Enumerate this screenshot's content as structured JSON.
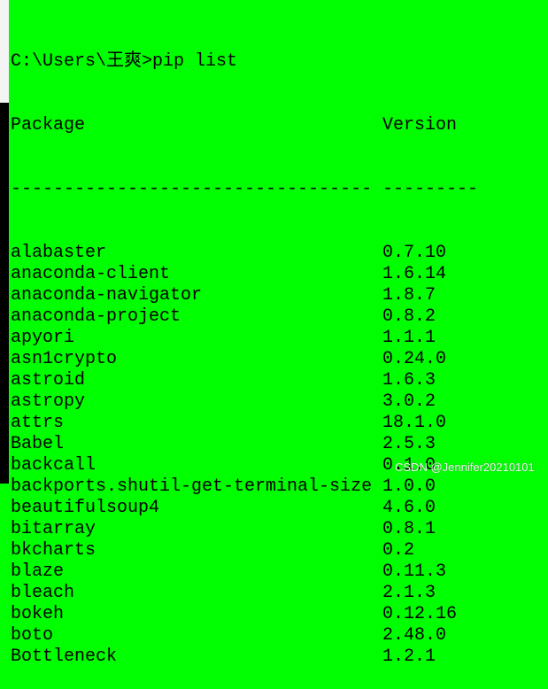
{
  "prompt": "C:\\Users\\王爽>pip list",
  "header": {
    "package": "Package",
    "version": "Version"
  },
  "separator": {
    "package": "----------------------------------",
    "version": "---------"
  },
  "packages": [
    {
      "name": "alabaster",
      "version": "0.7.10"
    },
    {
      "name": "anaconda-client",
      "version": "1.6.14"
    },
    {
      "name": "anaconda-navigator",
      "version": "1.8.7"
    },
    {
      "name": "anaconda-project",
      "version": "0.8.2"
    },
    {
      "name": "apyori",
      "version": "1.1.1"
    },
    {
      "name": "asn1crypto",
      "version": "0.24.0"
    },
    {
      "name": "astroid",
      "version": "1.6.3"
    },
    {
      "name": "astropy",
      "version": "3.0.2"
    },
    {
      "name": "attrs",
      "version": "18.1.0"
    },
    {
      "name": "Babel",
      "version": "2.5.3"
    },
    {
      "name": "backcall",
      "version": "0.1.0"
    },
    {
      "name": "backports.shutil-get-terminal-size",
      "version": "1.0.0"
    },
    {
      "name": "beautifulsoup4",
      "version": "4.6.0"
    },
    {
      "name": "bitarray",
      "version": "0.8.1"
    },
    {
      "name": "bkcharts",
      "version": "0.2"
    },
    {
      "name": "blaze",
      "version": "0.11.3"
    },
    {
      "name": "bleach",
      "version": "2.1.3"
    },
    {
      "name": "bokeh",
      "version": "0.12.16"
    },
    {
      "name": "boto",
      "version": "2.48.0"
    },
    {
      "name": "Bottleneck",
      "version": "1.2.1"
    }
  ],
  "watermark": "CSDN @Jennifer20210101",
  "colors": {
    "background": "#00ff00",
    "text": "#000000"
  }
}
